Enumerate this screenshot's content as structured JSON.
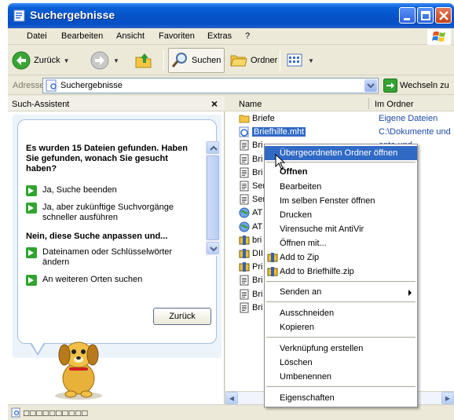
{
  "window": {
    "title": "Suchergebnisse",
    "colors": {
      "titlebar": "#0552c7",
      "selection": "#316ac5",
      "accent_green": "#2fa52f"
    }
  },
  "menubar": {
    "items": [
      "Datei",
      "Bearbeiten",
      "Ansicht",
      "Favoriten",
      "Extras",
      "?"
    ]
  },
  "toolbar": {
    "back_label": "Zurück",
    "search_label": "Suchen",
    "folders_label": "Ordner"
  },
  "addressbar": {
    "label": "Adresse",
    "value": "Suchergebnisse",
    "go_label": "Wechseln zu"
  },
  "search_assistant": {
    "title": "Such-Assistent",
    "close_glyph": "×",
    "heading": "Es wurden 15 Dateien gefunden. Haben Sie gefunden, wonach Sie gesucht haben?",
    "option_yes_finish": "Ja, Suche beenden",
    "option_yes_faster": "Ja, aber zukünftige Suchvorgänge schneller ausführen",
    "subheading": "Nein, diese Suche anpassen und...",
    "option_names": "Dateinamen oder Schlüsselwörter ändern",
    "option_other_places": "An weiteren Orten suchen",
    "back_button": "Zurück"
  },
  "columns": {
    "name": "Name",
    "folder": "Im Ordner"
  },
  "files": [
    {
      "name": "Briefe",
      "folder": "Eigene Dateien",
      "icon": "folder-icon"
    },
    {
      "name": "Briefhilfe.mht",
      "folder": "C:\\Dokumente und",
      "icon": "ie-document-icon"
    },
    {
      "name": "Bri",
      "folder": "ente und",
      "icon": "document-icon"
    },
    {
      "name": "Bri",
      "folder": "ente und",
      "icon": "document-icon"
    },
    {
      "name": "Bri",
      "folder": "ente und",
      "icon": "document-icon"
    },
    {
      "name": "Ser",
      "folder": "ente und",
      "icon": "document-icon"
    },
    {
      "name": "Ser",
      "folder": "ente und",
      "icon": "document-icon"
    },
    {
      "name": "AT",
      "folder": "ente und",
      "icon": "globe-icon"
    },
    {
      "name": "AT",
      "folder": "ente und",
      "icon": "globe-icon"
    },
    {
      "name": "bri",
      "folder": "ente und",
      "icon": "zip-icon"
    },
    {
      "name": "DII",
      "folder": "ente und",
      "icon": "zip-icon"
    },
    {
      "name": "Pri",
      "folder": "ente und",
      "icon": "zip-icon"
    },
    {
      "name": "Bri",
      "folder": "ente und",
      "icon": "document-icon"
    },
    {
      "name": "Bri",
      "folder": "ente und",
      "icon": "document-icon"
    },
    {
      "name": "Bri",
      "folder": "ente und",
      "icon": "document-icon"
    }
  ],
  "context_menu": {
    "open_parent": "Übergeordneten Ordner öffnen",
    "open": "Öffnen",
    "edit": "Bearbeiten",
    "open_same_window": "Im selben Fenster öffnen",
    "print": "Drucken",
    "virus_scan": "Virensuche mit AntiVir",
    "open_with": "Öffnen mit...",
    "add_zip": "Add to Zip",
    "add_named_zip": "Add to Briefhilfe.zip",
    "send_to": "Senden an",
    "cut": "Ausschneiden",
    "copy": "Kopieren",
    "create_shortcut": "Verknüpfung erstellen",
    "delete": "Löschen",
    "rename": "Umbenennen",
    "properties": "Eigenschaften"
  },
  "statusbar": {
    "text": "□□□□□□□□□□"
  }
}
